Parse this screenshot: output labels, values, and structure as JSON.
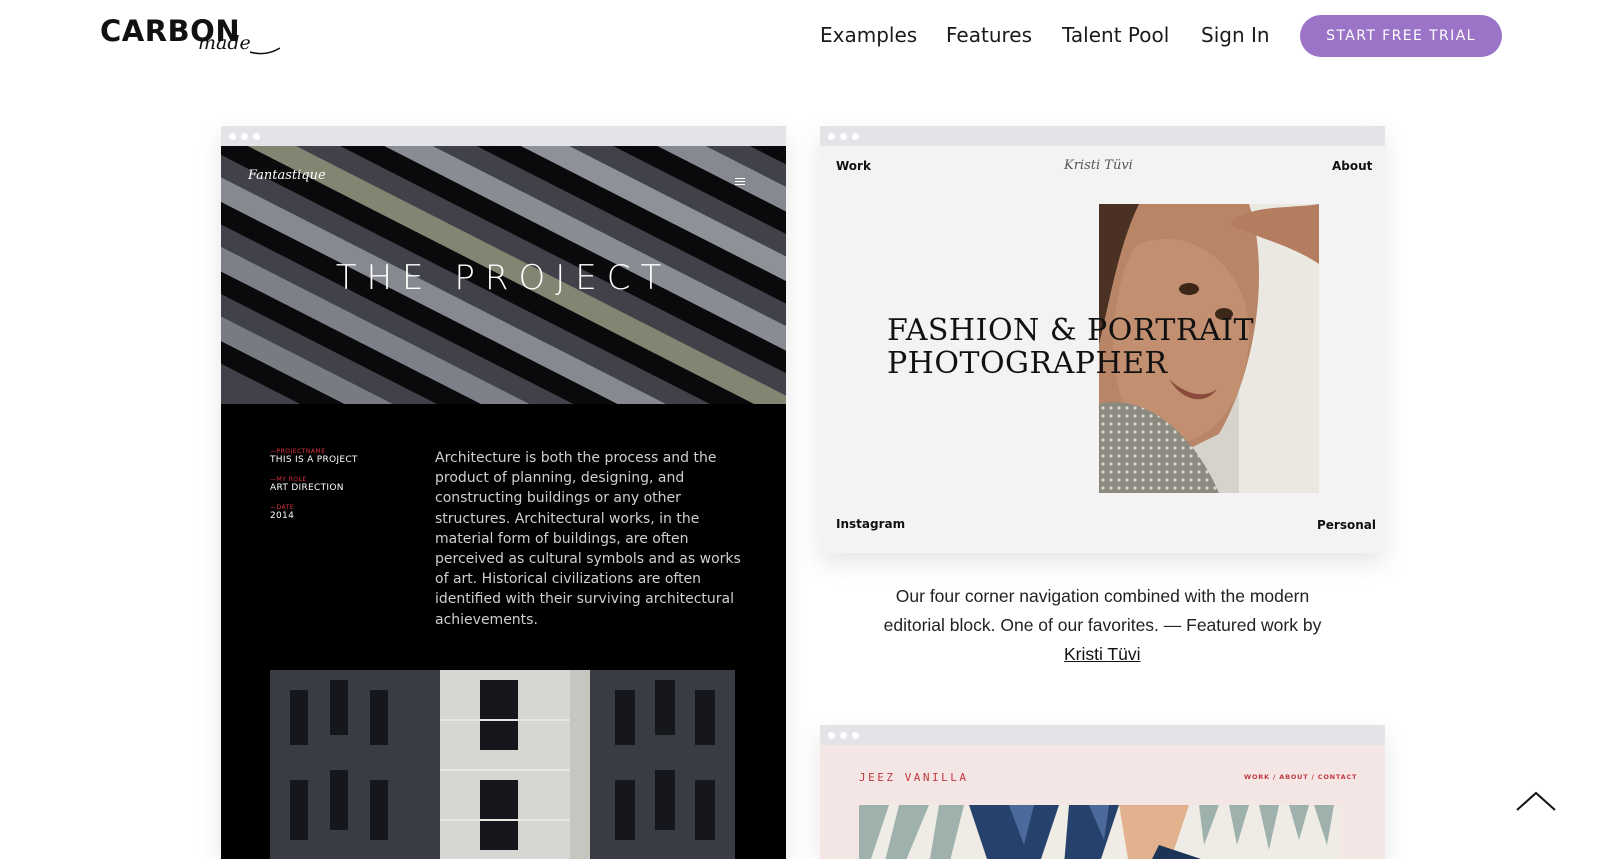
{
  "header": {
    "logo_main": "CARBON",
    "logo_script": "made",
    "nav": [
      "Examples",
      "Features",
      "Talent Pool",
      "Sign In"
    ],
    "cta": "START FREE TRIAL"
  },
  "colors": {
    "accent": "#9b74c7",
    "red": "#c0393f",
    "frame_bar": "#e3e4e8"
  },
  "showcase": [
    {
      "logo": "Fantastique",
      "title": "THE PROJECT",
      "meta": [
        {
          "label": "—PROJECTNAME",
          "value": "THIS IS A PROJECT"
        },
        {
          "label": "—MY ROLE",
          "value": "ART DIRECTION"
        },
        {
          "label": "—DATE",
          "value": "2014"
        }
      ],
      "body": "Architecture is both the process and the product of planning, designing, and constructing buildings or any other structures. Architectural works, in the material form of buildings, are often perceived as cultural symbols and as works of art. Historical civilizations are often identified with their surviving architectural achievements."
    },
    {
      "top_left": "Work",
      "script_name": "Kristi Tüvi",
      "top_right": "About",
      "headline_line1": "FASHION & PORTRAIT",
      "headline_line2": "PHOTOGRAPHER",
      "bottom_left": "Instagram",
      "bottom_right": "Personal"
    },
    {
      "brand": "JEEZ VANILLA",
      "nav": "WORK / ABOUT / CONTACT"
    }
  ],
  "caption": {
    "text": "Our four corner navigation combined with the modern editorial block. One of our favorites. — Featured work by",
    "link": "Kristi Tüvi"
  },
  "scroll_top_icon": "chevron-up-icon"
}
